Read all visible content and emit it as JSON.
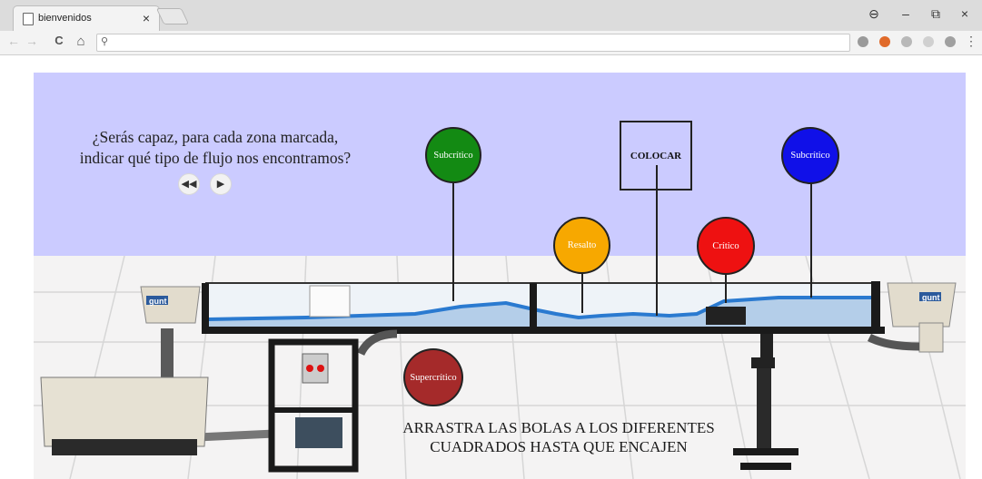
{
  "browser": {
    "tab_title": "bienvenidos",
    "tab_close": "×",
    "url": "",
    "nav": {
      "back": "←",
      "forward": "→",
      "reload": "C",
      "home": "⌂",
      "search_icon": "⚲"
    },
    "window": {
      "account": "⊖",
      "minimize": "–",
      "restore": "⧉",
      "close": "×",
      "menu": "⋮"
    }
  },
  "page": {
    "question_line1": "¿Serás capaz, para cada zona marcada,",
    "question_line2": "indicar qué tipo de flujo nos encontramos?",
    "controls": {
      "rewind": "◀◀",
      "play": "▶"
    },
    "dropzone_label": "COLOCAR",
    "instructions_line1": "ARRASTRA LAS BOLAS A LOS DIFERENTES",
    "instructions_line2": "CUADRADOS HASTA QUE ENCAJEN",
    "brand_left": "gunt",
    "brand_right": "gunt",
    "balls": [
      {
        "label": "Subcrítico",
        "color": "#138a13"
      },
      {
        "label": "Resalto",
        "color": "#f7a800"
      },
      {
        "label": "Crítico",
        "color": "#ee1111"
      },
      {
        "label": "Subcrítico",
        "color": "#1010e8"
      },
      {
        "label": "Supercrítico",
        "color": "#a52a2a"
      }
    ]
  }
}
